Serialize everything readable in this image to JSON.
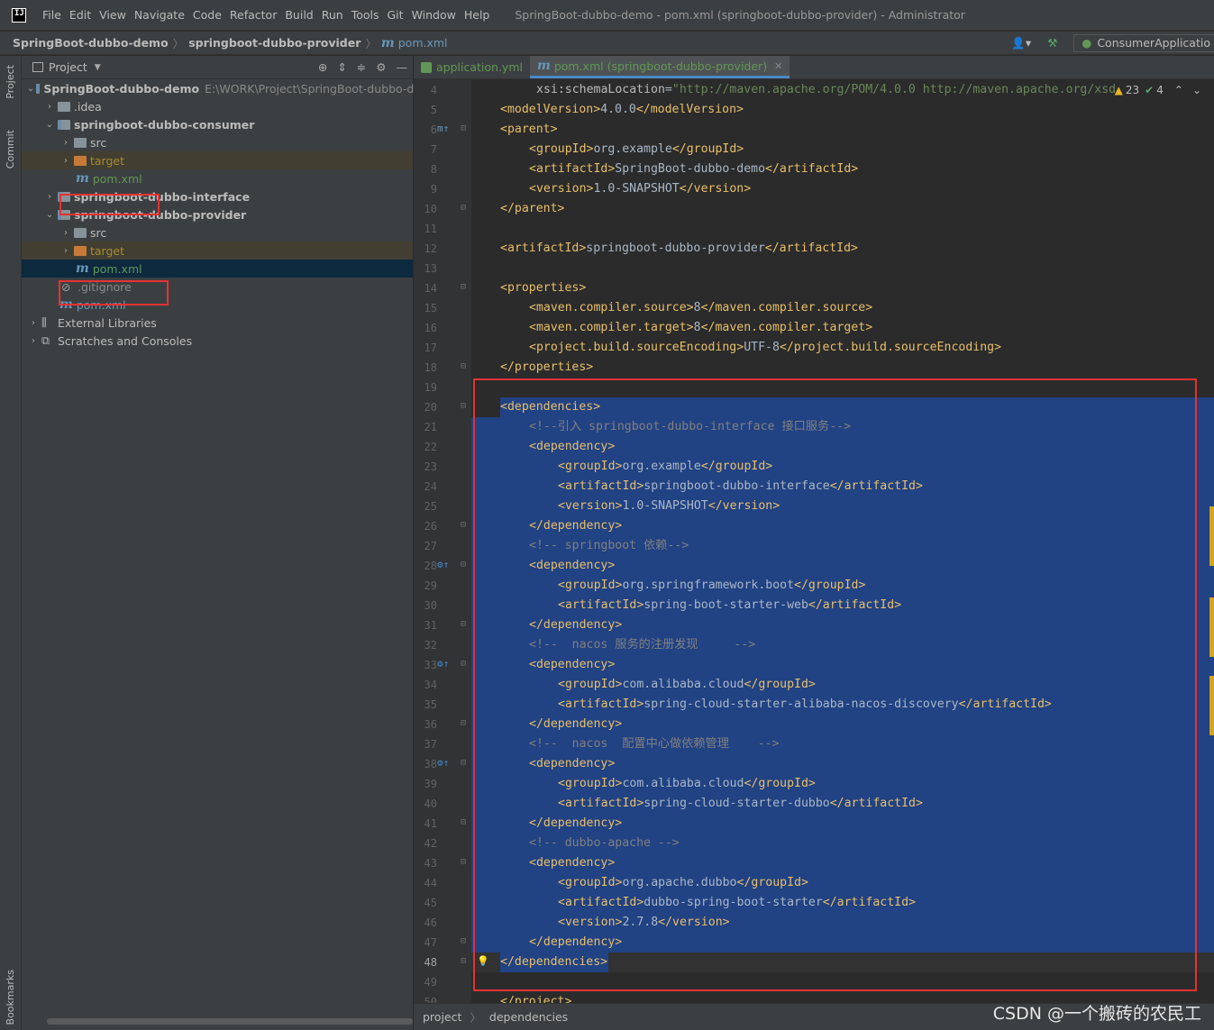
{
  "menubar": {
    "logo": "IJ",
    "items": [
      "File",
      "Edit",
      "View",
      "Navigate",
      "Code",
      "Refactor",
      "Build",
      "Run",
      "Tools",
      "Git",
      "Window",
      "Help"
    ],
    "window_title": "SpringBoot-dubbo-demo - pom.xml (springboot-dubbo-provider) - Administrator"
  },
  "navbar": {
    "crumbs": [
      "SpringBoot-dubbo-demo",
      "springboot-dubbo-provider",
      "pom.xml"
    ],
    "run_config": "ConsumerApplicatio"
  },
  "left_strip": {
    "project": "Project",
    "commit": "Commit",
    "bookmarks": "Bookmarks"
  },
  "project_panel": {
    "title": "Project",
    "tree": [
      {
        "label": "SpringBoot-dubbo-demo",
        "path": "E:\\WORK\\Project\\SpringBoot-dubbo-de"
      },
      {
        "label": ".idea"
      },
      {
        "label": "springboot-dubbo-consumer"
      },
      {
        "label": "src"
      },
      {
        "label": "target"
      },
      {
        "label": "pom.xml"
      },
      {
        "label": "springboot-dubbo-interface"
      },
      {
        "label": "springboot-dubbo-provider"
      },
      {
        "label": "src"
      },
      {
        "label": "target"
      },
      {
        "label": "pom.xml"
      },
      {
        "label": ".gitignore"
      },
      {
        "label": "pom.xml"
      },
      {
        "label": "External Libraries"
      },
      {
        "label": "Scratches and Consoles"
      }
    ]
  },
  "editor": {
    "tabs": [
      {
        "label": "application.yml"
      },
      {
        "label": "pom.xml (springboot-dubbo-provider)"
      }
    ],
    "inspections": {
      "warnings": "23",
      "ok": "4"
    },
    "line_numbers": [
      "4",
      "5",
      "6",
      "7",
      "8",
      "9",
      "10",
      "11",
      "12",
      "13",
      "14",
      "15",
      "16",
      "17",
      "18",
      "19",
      "20",
      "21",
      "22",
      "23",
      "24",
      "25",
      "26",
      "27",
      "28",
      "29",
      "30",
      "31",
      "32",
      "33",
      "34",
      "35",
      "36",
      "37",
      "38",
      "39",
      "40",
      "41",
      "42",
      "43",
      "44",
      "45",
      "46",
      "47",
      "48",
      "49",
      "50"
    ],
    "lines": [
      "xsi:schemaLocation=\"http://maven.apache.org/POM/4.0.0 http://maven.apache.org/xsd",
      "<modelVersion>4.0.0</modelVersion>",
      "<parent>",
      "<groupId>org.example</groupId>",
      "<artifactId>SpringBoot-dubbo-demo</artifactId>",
      "<version>1.0-SNAPSHOT</version>",
      "</parent>",
      "",
      "<artifactId>springboot-dubbo-provider</artifactId>",
      "",
      "<properties>",
      "<maven.compiler.source>8</maven.compiler.source>",
      "<maven.compiler.target>8</maven.compiler.target>",
      "<project.build.sourceEncoding>UTF-8</project.build.sourceEncoding>",
      "</properties>",
      "",
      "<dependencies>",
      "<!--引入 springboot-dubbo-interface 接口服务-->",
      "<dependency>",
      "<groupId>org.example</groupId>",
      "<artifactId>springboot-dubbo-interface</artifactId>",
      "<version>1.0-SNAPSHOT</version>",
      "</dependency>",
      "<!-- springboot 依赖-->",
      "<dependency>",
      "<groupId>org.springframework.boot</groupId>",
      "<artifactId>spring-boot-starter-web</artifactId>",
      "</dependency>",
      "<!--  nacos 服务的注册发现     -->",
      "<dependency>",
      "<groupId>com.alibaba.cloud</groupId>",
      "<artifactId>spring-cloud-starter-alibaba-nacos-discovery</artifactId>",
      "</dependency>",
      "<!--  nacos  配置中心做依赖管理    -->",
      "<dependency>",
      "<groupId>com.alibaba.cloud</groupId>",
      "<artifactId>spring-cloud-starter-dubbo</artifactId>",
      "</dependency>",
      "<!-- dubbo-apache -->",
      "<dependency>",
      "<groupId>org.apache.dubbo</groupId>",
      "<artifactId>dubbo-spring-boot-starter</artifactId>",
      "<version>2.7.8</version>",
      "</dependency>",
      "</dependencies>",
      "",
      "</project>"
    ]
  },
  "bottom": {
    "crumbs": [
      "project",
      "dependencies"
    ]
  },
  "watermark": "CSDN @一个搬砖的农民工",
  "colors": {
    "selection": "#214283",
    "highlight_box": "#e53232",
    "tag": "#e8bf6a",
    "comment": "#808080"
  }
}
